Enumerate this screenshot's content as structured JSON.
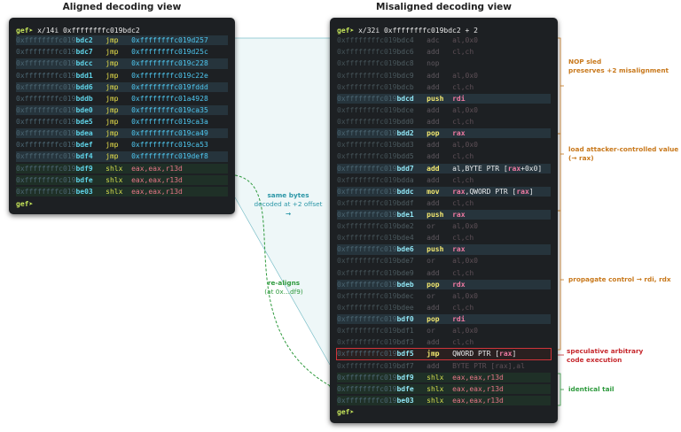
{
  "left_title": "Aligned decoding view",
  "right_title": "Misaligned decoding view",
  "left_prompt": "gef➤",
  "left_cmd": " x/14i 0xffffffffc019bdc2",
  "left_rows": [
    {
      "ap": "0xffffffffc019",
      "as": "bdc2",
      "m": "jmp",
      "op": "0xffffffffc019d257",
      "t": "j"
    },
    {
      "ap": "0xffffffffc019",
      "as": "bdc7",
      "m": "jmp",
      "op": "0xffffffffc019d25c",
      "t": "j"
    },
    {
      "ap": "0xffffffffc019",
      "as": "bdcc",
      "m": "jmp",
      "op": "0xffffffffc019c228",
      "t": "j"
    },
    {
      "ap": "0xffffffffc019",
      "as": "bdd1",
      "m": "jmp",
      "op": "0xffffffffc019c22e",
      "t": "j"
    },
    {
      "ap": "0xffffffffc019",
      "as": "bdd6",
      "m": "jmp",
      "op": "0xffffffffc019fddd",
      "t": "j"
    },
    {
      "ap": "0xffffffffc019",
      "as": "bddb",
      "m": "jmp",
      "op": "0xffffffffc01a4928",
      "t": "j"
    },
    {
      "ap": "0xffffffffc019",
      "as": "bde0",
      "m": "jmp",
      "op": "0xffffffffc019ca35",
      "t": "j"
    },
    {
      "ap": "0xffffffffc019",
      "as": "bde5",
      "m": "jmp",
      "op": "0xffffffffc019ca3a",
      "t": "j"
    },
    {
      "ap": "0xffffffffc019",
      "as": "bdea",
      "m": "jmp",
      "op": "0xffffffffc019ca49",
      "t": "j"
    },
    {
      "ap": "0xffffffffc019",
      "as": "bdef",
      "m": "jmp",
      "op": "0xffffffffc019ca53",
      "t": "j"
    },
    {
      "ap": "0xffffffffc019",
      "as": "bdf4",
      "m": "jmp",
      "op": "0xffffffffc019def8",
      "t": "j"
    },
    {
      "ap": "0xffffffffc019",
      "as": "bdf9",
      "m": "shlx",
      "op": "eax,eax,r13d",
      "t": "s"
    },
    {
      "ap": "0xffffffffc019",
      "as": "bdfe",
      "m": "shlx",
      "op": "eax,eax,r13d",
      "t": "s"
    },
    {
      "ap": "0xffffffffc019",
      "as": "be03",
      "m": "shlx",
      "op": "eax,eax,r13d",
      "t": "s"
    }
  ],
  "left_end_prompt": "gef➤",
  "right_prompt": "gef➤",
  "right_cmd": " x/32i 0xffffffffc019bdc2 + 2",
  "right_rows": [
    {
      "ap": "0xffffffffc019",
      "as": "bdc4",
      "m": "adc",
      "op": "al,0x0",
      "t": "d"
    },
    {
      "ap": "0xffffffffc019",
      "as": "bdc6",
      "m": "add",
      "op": "cl,ch",
      "t": "d"
    },
    {
      "ap": "0xffffffffc019",
      "as": "bdc8",
      "m": "nop",
      "op": "",
      "t": "d"
    },
    {
      "ap": "0xffffffffc019",
      "as": "bdc9",
      "m": "add",
      "op": "al,0x0",
      "t": "d"
    },
    {
      "ap": "0xffffffffc019",
      "as": "bdcb",
      "m": "add",
      "op": "cl,ch",
      "t": "d"
    },
    {
      "ap": "0xffffffffc019",
      "as": "bdcd",
      "m": "push",
      "op": "rdi",
      "t": "b"
    },
    {
      "ap": "0xffffffffc019",
      "as": "bdce",
      "m": "add",
      "op": "al,0x0",
      "t": "d"
    },
    {
      "ap": "0xffffffffc019",
      "as": "bdd0",
      "m": "add",
      "op": "cl,ch",
      "t": "d"
    },
    {
      "ap": "0xffffffffc019",
      "as": "bdd2",
      "m": "pop",
      "op": "rax",
      "t": "b"
    },
    {
      "ap": "0xffffffffc019",
      "as": "bdd3",
      "m": "add",
      "op": "al,0x0",
      "t": "d"
    },
    {
      "ap": "0xffffffffc019",
      "as": "bdd5",
      "m": "add",
      "op": "cl,ch",
      "t": "d"
    },
    {
      "ap": "0xffffffffc019",
      "as": "bdd7",
      "m": "add",
      "op": "al,BYTE PTR [rax+0x0]",
      "t": "b"
    },
    {
      "ap": "0xffffffffc019",
      "as": "bdda",
      "m": "add",
      "op": "cl,ch",
      "t": "d"
    },
    {
      "ap": "0xffffffffc019",
      "as": "bddc",
      "m": "mov",
      "op": "rax,QWORD PTR [rax]",
      "t": "b"
    },
    {
      "ap": "0xffffffffc019",
      "as": "bddf",
      "m": "add",
      "op": "cl,ch",
      "t": "d"
    },
    {
      "ap": "0xffffffffc019",
      "as": "bde1",
      "m": "push",
      "op": "rax",
      "t": "b"
    },
    {
      "ap": "0xffffffffc019",
      "as": "bde2",
      "m": "or",
      "op": "al,0x0",
      "t": "d"
    },
    {
      "ap": "0xffffffffc019",
      "as": "bde4",
      "m": "add",
      "op": "cl,ch",
      "t": "d"
    },
    {
      "ap": "0xffffffffc019",
      "as": "bde6",
      "m": "push",
      "op": "rax",
      "t": "b"
    },
    {
      "ap": "0xffffffffc019",
      "as": "bde7",
      "m": "or",
      "op": "al,0x0",
      "t": "d"
    },
    {
      "ap": "0xffffffffc019",
      "as": "bde9",
      "m": "add",
      "op": "cl,ch",
      "t": "d"
    },
    {
      "ap": "0xffffffffc019",
      "as": "bdeb",
      "m": "pop",
      "op": "rdx",
      "t": "b"
    },
    {
      "ap": "0xffffffffc019",
      "as": "bdec",
      "m": "or",
      "op": "al,0x0",
      "t": "d"
    },
    {
      "ap": "0xffffffffc019",
      "as": "bdee",
      "m": "add",
      "op": "cl,ch",
      "t": "d"
    },
    {
      "ap": "0xffffffffc019",
      "as": "bdf0",
      "m": "pop",
      "op": "rdi",
      "t": "b"
    },
    {
      "ap": "0xffffffffc019",
      "as": "bdf1",
      "m": "or",
      "op": "al,0x0",
      "t": "d"
    },
    {
      "ap": "0xffffffffc019",
      "as": "bdf3",
      "m": "add",
      "op": "cl,ch",
      "t": "d"
    },
    {
      "ap": "0xffffffffc019",
      "as": "bdf5",
      "m": "jmp",
      "op": "QWORD PTR [rax]",
      "t": "r"
    },
    {
      "ap": "0xffffffffc019",
      "as": "bdf7",
      "m": "add",
      "op": "BYTE PTR [rax],al",
      "t": "d"
    },
    {
      "ap": "0xffffffffc019",
      "as": "bdf9",
      "m": "shlx",
      "op": "eax,eax,r13d",
      "t": "g"
    },
    {
      "ap": "0xffffffffc019",
      "as": "bdfe",
      "m": "shlx",
      "op": "eax,eax,r13d",
      "t": "g"
    },
    {
      "ap": "0xffffffffc019",
      "as": "be03",
      "m": "shlx",
      "op": "eax,eax,r13d",
      "t": "g"
    }
  ],
  "right_end_prompt": "gef➤",
  "annotations": {
    "same_bytes_title": "same bytes",
    "same_bytes_sub": "decoded at +2 offset",
    "same_bytes_arrow": "→",
    "realigns_title": "re-aligns",
    "realigns_sub": "(at 0x…df9)",
    "nop_sled_1": "NOP sled",
    "nop_sled_2": "preserves +2 misalignment",
    "load_1": "load attacker-controlled value",
    "load_2": "(→ rax)",
    "propagate": "propagate control → rdi, rdx",
    "spec_1": "speculative arbitrary",
    "spec_2": "code execution",
    "tail": "identical tail"
  },
  "colors": {
    "teal": "#2c97a7",
    "green": "#2e9a3d",
    "orange": "#c8781b",
    "red": "#c6282d"
  }
}
